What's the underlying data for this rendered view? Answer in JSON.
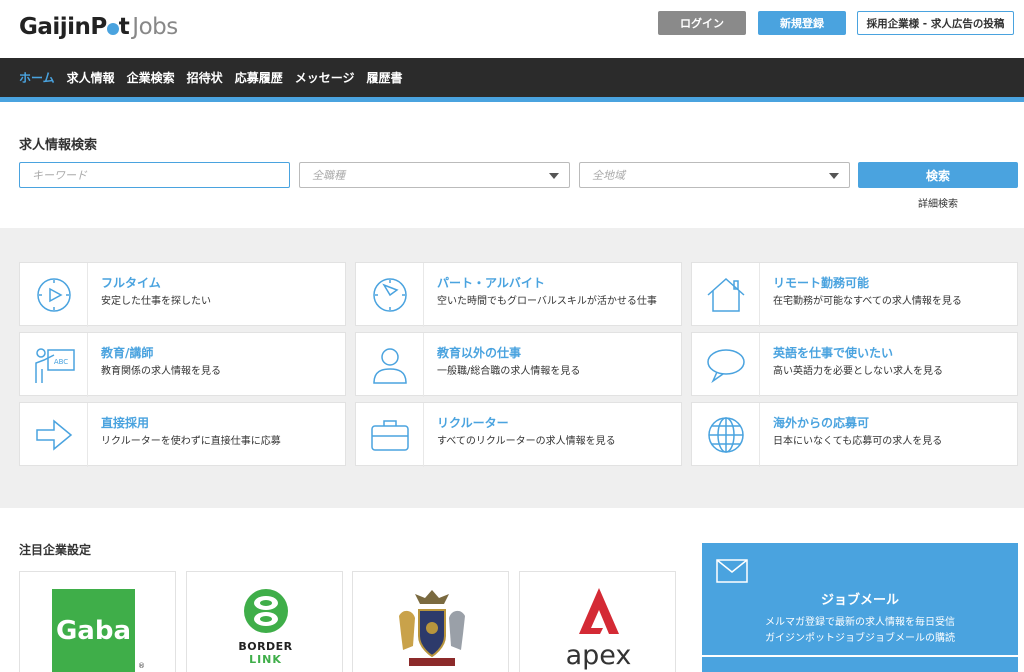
{
  "header": {
    "logo_main": "GaijinP",
    "logo_tail": "t",
    "logo_sub": "Jobs",
    "login": "ログイン",
    "register": "新規登録",
    "employer": "採用企業様 - 求人広告の投稿"
  },
  "nav": [
    "ホーム",
    "求人情報",
    "企業検索",
    "招待状",
    "応募履歴",
    "メッセージ",
    "履歴書"
  ],
  "search": {
    "title": "求人情報検索",
    "keyword_placeholder": "キーワード",
    "category": "全職種",
    "region": "全地域",
    "button": "検索",
    "detail": "詳細検索"
  },
  "categories": [
    {
      "title": "フルタイム",
      "desc": "安定した仕事を探したい",
      "icon": "clock-play-icon"
    },
    {
      "title": "パート・アルバイト",
      "desc": "空いた時間でもグローバルスキルが活かせる仕事",
      "icon": "clock-pie-icon"
    },
    {
      "title": "リモート勤務可能",
      "desc": "在宅勤務が可能なすべての求人情報を見る",
      "icon": "house-icon"
    },
    {
      "title": "教育/講師",
      "desc": "教育関係の求人情報を見る",
      "icon": "teacher-icon"
    },
    {
      "title": "教育以外の仕事",
      "desc": "一般職/総合職の求人情報を見る",
      "icon": "person-icon"
    },
    {
      "title": "英語を仕事で使いたい",
      "desc": "高い英語力を必要としない求人を見る",
      "icon": "speech-bubble-icon"
    },
    {
      "title": "直接採用",
      "desc": "リクルーターを使わずに直接仕事に応募",
      "icon": "arrow-right-icon"
    },
    {
      "title": "リクルーター",
      "desc": "すべてのリクルーターの求人情報を見る",
      "icon": "briefcase-icon"
    },
    {
      "title": "海外からの応募可",
      "desc": "日本にいなくても応募可の求人を見る",
      "icon": "globe-icon"
    }
  ],
  "featured": {
    "title": "注目企業設定",
    "gaba": "Gaba",
    "gaba_r": "®",
    "border_1": "BORDER",
    "border_2": "LINK",
    "apex": "apex"
  },
  "mail": {
    "title": "ジョブメール",
    "desc1": "メルマガ登録で最新の求人情報を毎日受信",
    "desc2": "ガイジンポットジョブジョブメールの購読"
  },
  "colors": {
    "accent": "#4aa3df",
    "nav_bg": "#2b2b2b",
    "gaba_green": "#3fae49"
  }
}
